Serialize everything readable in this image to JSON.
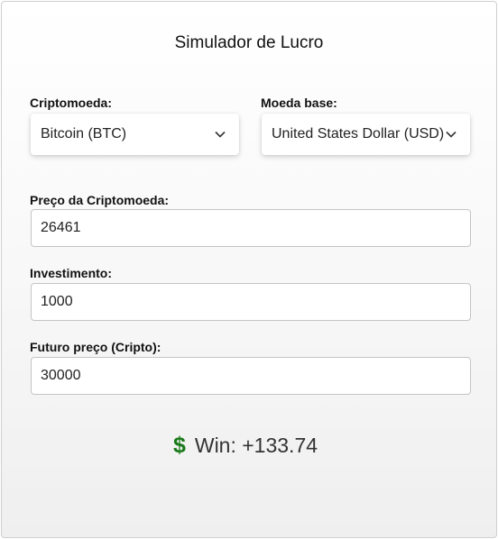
{
  "title": "Simulador de Lucro",
  "crypto": {
    "label": "Criptomoeda:",
    "selected": "Bitcoin (BTC)"
  },
  "base": {
    "label": "Moeda base:",
    "selected": "United States Dollar (USD)"
  },
  "price": {
    "label": "Preço da Criptomoeda:",
    "value": "26461"
  },
  "investment": {
    "label": "Investimento:",
    "value": "1000"
  },
  "future": {
    "label": "Futuro preço (Cripto):",
    "value": "30000"
  },
  "result": {
    "icon": "dollar-icon",
    "icon_glyph": "$",
    "icon_color": "#1a7a1a",
    "text": "Win: +133.74"
  }
}
